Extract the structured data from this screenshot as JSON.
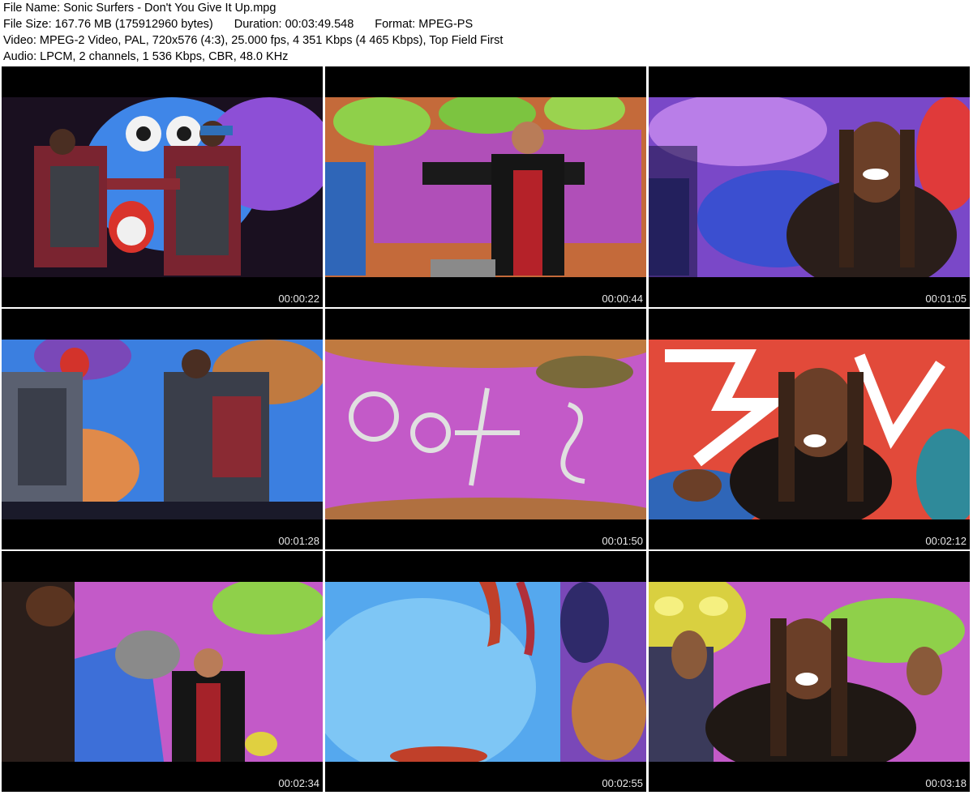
{
  "header": {
    "file_name": "File Name: Sonic Surfers - Don't You Give It Up.mpg",
    "file_size": "File Size: 167.76 MB (175912960 bytes)",
    "duration": "Duration: 00:03:49.548",
    "format": "Format: MPEG-PS",
    "video": "Video: MPEG-2 Video, PAL, 720x576 (4:3), 25.000 fps, 4 351 Kbps (4 465 Kbps), Top Field First",
    "audio": "Audio: LPCM, 2 channels, 1 536 Kbps, CBR, 48.0 KHz"
  },
  "thumbnails": [
    {
      "timestamp": "00:00:22"
    },
    {
      "timestamp": "00:00:44"
    },
    {
      "timestamp": "00:01:05"
    },
    {
      "timestamp": "00:01:28"
    },
    {
      "timestamp": "00:01:50"
    },
    {
      "timestamp": "00:02:12"
    },
    {
      "timestamp": "00:02:34"
    },
    {
      "timestamp": "00:02:55"
    },
    {
      "timestamp": "00:03:18"
    }
  ]
}
